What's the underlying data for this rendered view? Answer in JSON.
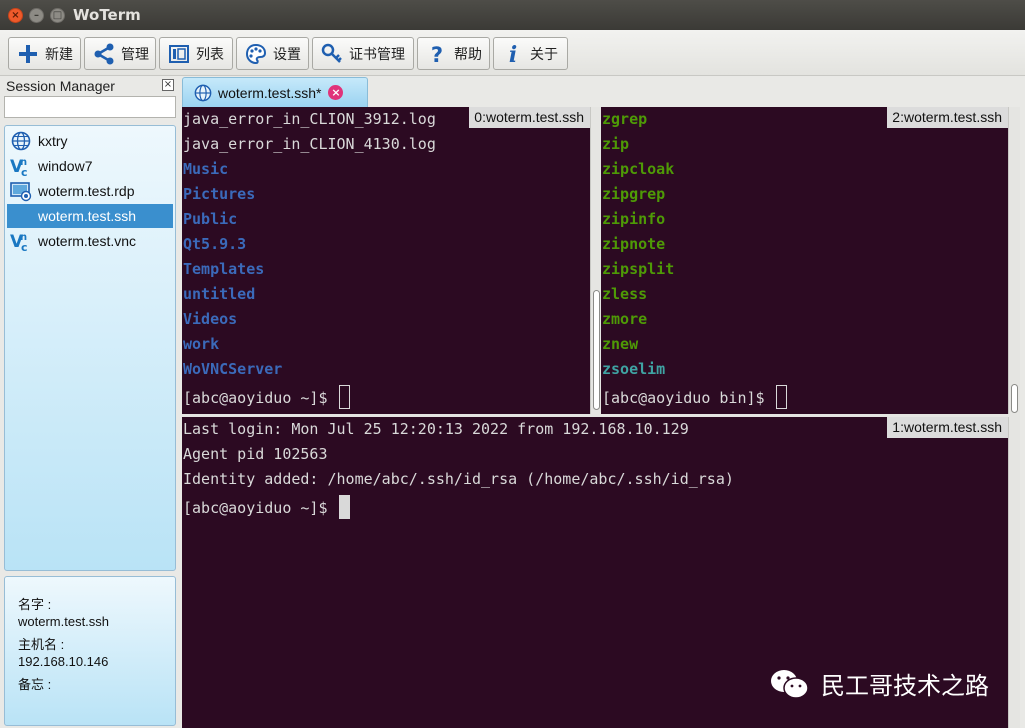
{
  "window": {
    "title": "WoTerm",
    "close": "×",
    "minimize": "–",
    "maximize": "□"
  },
  "toolbar": [
    {
      "label": "新建",
      "icon": "plus-icon"
    },
    {
      "label": "管理",
      "icon": "share-icon"
    },
    {
      "label": "列表",
      "icon": "list-icon"
    },
    {
      "label": "设置",
      "icon": "palette-icon"
    },
    {
      "label": "证书管理",
      "icon": "key-icon"
    },
    {
      "label": "帮助",
      "icon": "question-icon"
    },
    {
      "label": "关于",
      "icon": "info-icon"
    }
  ],
  "session_manager": {
    "title": "Session Manager",
    "close": "×",
    "search_value": "",
    "items": [
      {
        "name": "kxtry",
        "icon": "globe-icon",
        "selected": false
      },
      {
        "name": "window7",
        "icon": "vnc-icon",
        "selected": false
      },
      {
        "name": "woterm.test.rdp",
        "icon": "rdp-icon",
        "selected": false
      },
      {
        "name": "woterm.test.ssh",
        "icon": "ssh-icon",
        "selected": true
      },
      {
        "name": "woterm.test.vnc",
        "icon": "vnc-icon",
        "selected": false
      }
    ],
    "info": {
      "name_label": "名字 :",
      "name_value": "woterm.test.ssh",
      "host_label": "主机名 :",
      "host_value": "192.168.10.146",
      "memo_label": "备忘 :"
    }
  },
  "tab": {
    "label": "woterm.test.ssh*",
    "close": "×"
  },
  "panes": {
    "p0": {
      "label": "0:woterm.test.ssh",
      "lines": [
        {
          "text": "java_error_in_CLION_3912.log",
          "style": "plain"
        },
        {
          "text": "java_error_in_CLION_4130.log",
          "style": "plain"
        },
        {
          "text": "Music",
          "style": "dir"
        },
        {
          "text": "Pictures",
          "style": "dir"
        },
        {
          "text": "Public",
          "style": "dir"
        },
        {
          "text": "Qt5.9.3",
          "style": "dir"
        },
        {
          "text": "Templates",
          "style": "dir"
        },
        {
          "text": "untitled",
          "style": "dir"
        },
        {
          "text": "Videos",
          "style": "dir"
        },
        {
          "text": "work",
          "style": "dir"
        },
        {
          "text": "WoVNCServer",
          "style": "dir"
        }
      ],
      "prompt": "[abc@aoyiduo ~]$ "
    },
    "p2": {
      "label": "2:woterm.test.ssh",
      "lines": [
        {
          "text": "zgrep",
          "style": "exe"
        },
        {
          "text": "zip",
          "style": "exe"
        },
        {
          "text": "zipcloak",
          "style": "exe"
        },
        {
          "text": "zipgrep",
          "style": "exe"
        },
        {
          "text": "zipinfo",
          "style": "exe"
        },
        {
          "text": "zipnote",
          "style": "exe"
        },
        {
          "text": "zipsplit",
          "style": "exe"
        },
        {
          "text": "zless",
          "style": "exe"
        },
        {
          "text": "zmore",
          "style": "exe"
        },
        {
          "text": "znew",
          "style": "exe"
        },
        {
          "text": "zsoelim",
          "style": "exe2"
        }
      ],
      "prompt": "[abc@aoyiduo bin]$ "
    },
    "p1": {
      "label": "1:woterm.test.ssh",
      "lines": [
        {
          "text": "Last login: Mon Jul 25 12:20:13 2022 from 192.168.10.129",
          "style": "plain"
        },
        {
          "text": "Agent pid 102563",
          "style": "plain"
        },
        {
          "text": "Identity added: /home/abc/.ssh/id_rsa (/home/abc/.ssh/id_rsa)",
          "style": "plain"
        }
      ],
      "prompt": "[abc@aoyiduo ~]$ "
    }
  },
  "watermark": {
    "text": "民工哥技术之路",
    "icon": "wechat-icon"
  },
  "colors": {
    "terminal_bg": "#2c0a22",
    "dir": "#3b6aba",
    "exe": "#4e9a06",
    "selection": "#3a8fce"
  }
}
